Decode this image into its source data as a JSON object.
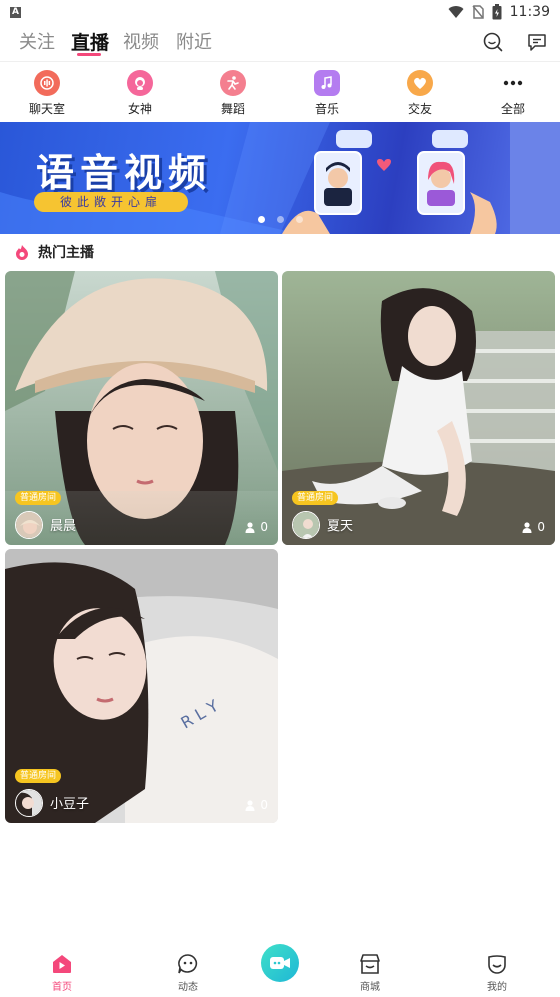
{
  "status_bar": {
    "time": "11:39",
    "notification_letter": "A"
  },
  "top_tabs": [
    {
      "label": "关注",
      "active": false
    },
    {
      "label": "直播",
      "active": true
    },
    {
      "label": "视频",
      "active": false
    },
    {
      "label": "附近",
      "active": false
    }
  ],
  "categories": [
    {
      "label": "聊天室",
      "icon": "chat-room-icon",
      "color": "#f26b5b"
    },
    {
      "label": "女神",
      "icon": "goddess-icon",
      "color": "#f5679a"
    },
    {
      "label": "舞蹈",
      "icon": "dance-icon",
      "color": "#f47f8f"
    },
    {
      "label": "音乐",
      "icon": "music-icon",
      "color": "#b47cf0"
    },
    {
      "label": "交友",
      "icon": "heart-icon",
      "color": "#f8a84a"
    },
    {
      "label": "全部",
      "icon": "more-icon",
      "color": "#ffffff"
    }
  ],
  "banner": {
    "title": "语音视频",
    "subtitle": "彼此敞开心扉",
    "dots": 3,
    "active_dot": 0
  },
  "section": {
    "title": "热门主播"
  },
  "streams": [
    {
      "name": "晨晨",
      "badge": "普通房间",
      "viewers": "0"
    },
    {
      "name": "夏天",
      "badge": "普通房间",
      "viewers": "0"
    },
    {
      "name": "小豆子",
      "badge": "普通房间",
      "viewers": "0"
    }
  ],
  "bottom_nav": [
    {
      "label": "首页",
      "icon": "home-icon",
      "active": true
    },
    {
      "label": "动态",
      "icon": "moments-icon",
      "active": false
    },
    {
      "label": "",
      "icon": "live-camera-icon",
      "active": false
    },
    {
      "label": "商城",
      "icon": "shop-icon",
      "active": false
    },
    {
      "label": "我的",
      "icon": "profile-icon",
      "active": false
    }
  ],
  "colors": {
    "accent": "#f4487b",
    "badge": "#f6c520",
    "center_button": "#2cc8d0"
  }
}
